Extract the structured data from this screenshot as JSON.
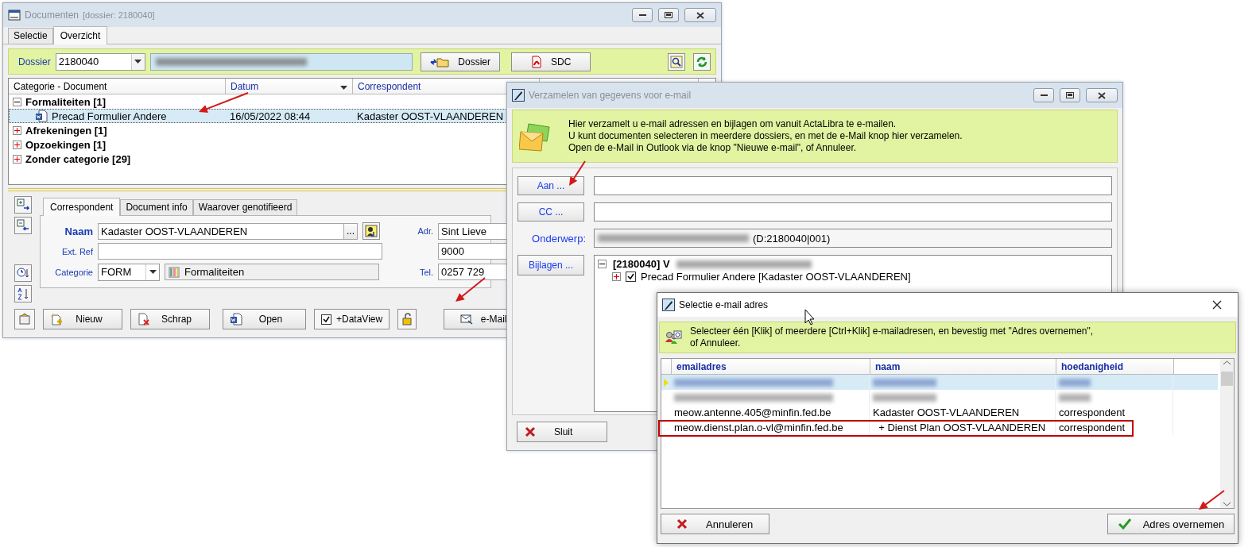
{
  "documents_window": {
    "title": "Documenten",
    "subtitle": "[dossier: 2180040]",
    "tabs": [
      {
        "label": "Selectie",
        "selected": false
      },
      {
        "label": "Overzicht",
        "selected": true
      }
    ],
    "dossier": {
      "label": "Dossier",
      "value": "2180040"
    },
    "buttons": [
      {
        "kind": "folder",
        "label": "Dossier"
      },
      {
        "kind": "pdf",
        "label": "SDC"
      }
    ],
    "columns": [
      "Categorie - Document",
      "Datum",
      "Correspondent"
    ],
    "tree": [
      {
        "label": "Formaliteiten [1]",
        "expanded": true,
        "children": [
          {
            "label": "Precad Formulier Andere",
            "datum": "16/05/2022 08:44",
            "correspondent": "Kadaster OOST-VLAANDEREN",
            "selected": true
          }
        ]
      },
      {
        "label": "Afrekeningen [1]",
        "expanded": false
      },
      {
        "label": "Opzoekingen [1]",
        "expanded": false
      },
      {
        "label": "Zonder categorie [29]",
        "expanded": false
      }
    ],
    "detail_tabs": [
      {
        "label": "Correspondent",
        "selected": true
      },
      {
        "label": "Document info",
        "selected": false
      },
      {
        "label": "Waarover genotifieerd",
        "selected": false
      }
    ],
    "naam": {
      "label": "Naam",
      "value": "Kadaster OOST-VLAANDEREN",
      "more": "..."
    },
    "ext_ref": {
      "label": "Ext. Ref"
    },
    "categorie": {
      "label": "Categorie",
      "code": "FORM",
      "name": "Formaliteiten"
    },
    "adres": {
      "label": "Adr.",
      "value": "Sint Lieve",
      "postcode": "9000"
    },
    "telefoon": {
      "label": "Tel.",
      "value": "0257 729"
    },
    "toolbar": [
      {
        "kind": "new",
        "label": "Nieuw"
      },
      {
        "kind": "delete",
        "label": "Schrap"
      },
      {
        "kind": "word",
        "label": "Open"
      }
    ],
    "dataview": {
      "label": "+DataView",
      "checked": true
    },
    "email_button": "e-Mail"
  },
  "collect_window": {
    "title": "Verzamelen van gegevens voor e-mail",
    "info": [
      "Hier verzamelt u e-mail adressen en bijlagen om vanuit ActaLibra te e-mailen.",
      "U kunt documenten selecteren in meerdere dossiers, en met de e-Mail knop hier verzamelen.",
      "Open de e-Mail in Outlook via de knop \"Nieuwe e-mail\", of Annuleer."
    ],
    "to_button": "Aan ...",
    "cc_button": "CC  ...",
    "subject_label": "Onderwerp:",
    "subject_value": "(D:2180040|001)",
    "attachments_button": "Bijlagen  ...",
    "attachments": {
      "label": "[2180040] V",
      "expanded": true,
      "children": [
        {
          "label": "Precad Formulier Andere [Kadaster OOST-VLAANDEREN]",
          "checked": true,
          "expanded": false
        }
      ]
    },
    "close_button": "Sluit"
  },
  "select_window": {
    "title": "Selectie e-mail adres",
    "info": [
      "Selecteer één [Klik] of meerdere [Ctrl+Klik] e-mailadresen, en bevestig met \"Adres overnemen\",",
      "of Annuleer."
    ],
    "columns": [
      "emailadres",
      "naam",
      "hoedanigheid"
    ],
    "rows": [
      {
        "kind": "blurred",
        "selected": true,
        "highlighted": false
      },
      {
        "kind": "blurred",
        "selected": false,
        "highlighted": false
      },
      {
        "kind": "plain",
        "selected": false,
        "highlighted": false,
        "email": "meow.antenne.405@minfin.fed.be",
        "naam": "Kadaster OOST-VLAANDEREN",
        "hoedanigheid": "correspondent"
      },
      {
        "kind": "plain",
        "selected": false,
        "highlighted": true,
        "email": "meow.dienst.plan.o-vl@minfin.fed.be",
        "naam": "  + Dienst Plan OOST-VLAANDEREN",
        "hoedanigheid": "correspondent"
      }
    ],
    "cancel_button": "Annuleren",
    "accept_button": "Adres overnemen"
  }
}
